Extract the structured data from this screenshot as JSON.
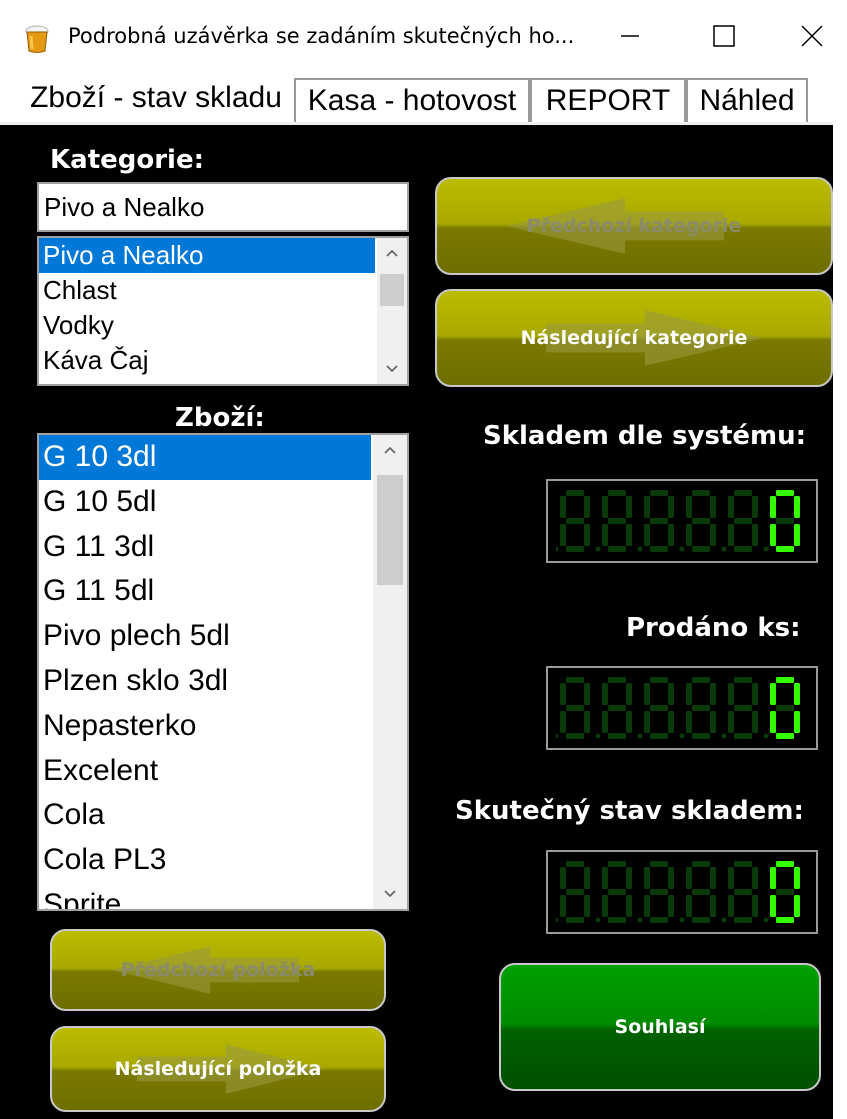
{
  "window": {
    "title": "Podrobná uzávěrka se zadáním skutečných ho...",
    "minimize_glyph": "minimize-icon",
    "maximize_glyph": "maximize-icon",
    "close_glyph": "close-icon"
  },
  "tabs": [
    {
      "label": "Zboží - stav skladu",
      "active": true
    },
    {
      "label": "Kasa - hotovost",
      "active": false
    },
    {
      "label": "REPORT",
      "active": false
    },
    {
      "label": "Náhled",
      "active": false
    }
  ],
  "category": {
    "label": "Kategorie:",
    "value": "Pivo a Nealko",
    "items": [
      "Pivo a Nealko",
      "Chlast",
      "Vodky",
      "Káva Čaj"
    ],
    "selected_index": 0
  },
  "goods": {
    "label": "Zboží:",
    "items": [
      "G 10 3dl",
      "G 10 5dl",
      "G 11 3dl",
      "G 11 5dl",
      "Pivo plech 5dl",
      "Plzen sklo 3dl",
      "Nepasterko",
      "Excelent",
      "Cola",
      "Cola PL3",
      "Sprite"
    ],
    "selected_index": 0
  },
  "buttons": {
    "prev_category": "Předchozí kategorie",
    "next_category": "Následující kategorie",
    "prev_item": "Předchozí položka",
    "next_item": "Následující položka",
    "agree": "Souhlasí"
  },
  "counters": {
    "system_stock_label": "Skladem dle systému:",
    "system_stock_value": 0,
    "sold_label": "Prodáno ks:",
    "sold_value": 0,
    "actual_stock_label": "Skutečný stav skladem:",
    "actual_stock_value": 0
  },
  "colors": {
    "selection": "#0078d7",
    "olive_button": "#a8a800",
    "green_button": "#008a00",
    "lcd_on": "#33ff00",
    "lcd_off": "#0a3a0a"
  }
}
